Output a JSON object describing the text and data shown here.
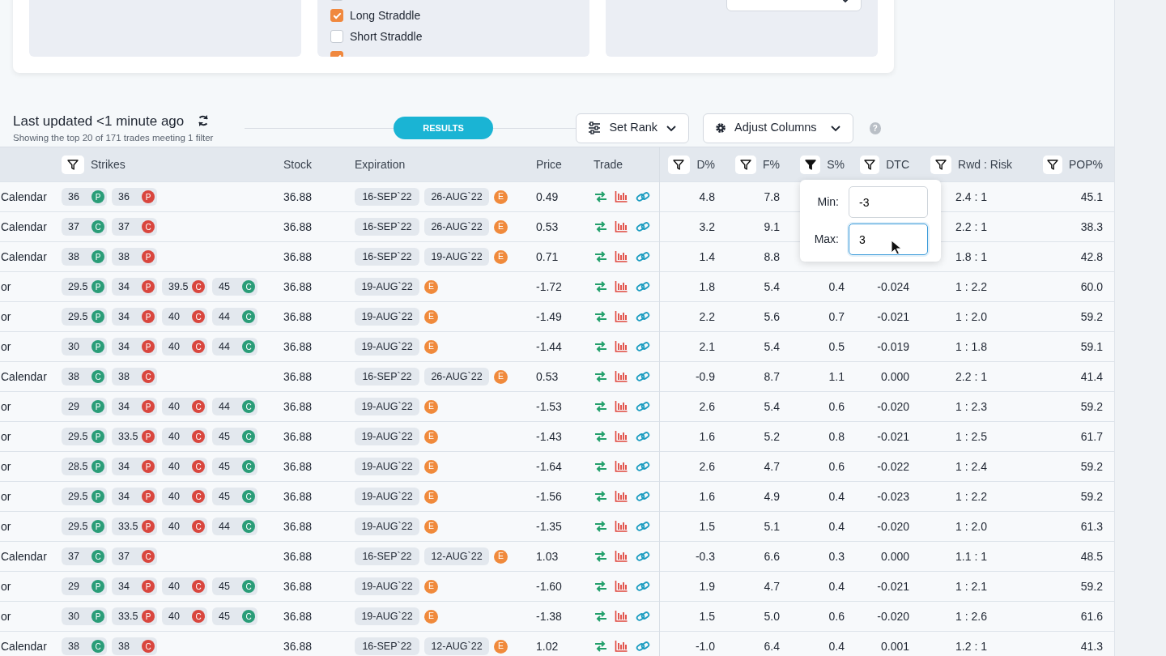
{
  "filters_panel": {
    "strategies": [
      {
        "checked": false
      },
      {
        "label": "Long Straddle",
        "checked": true
      },
      {
        "label": "Short Straddle",
        "checked": false
      },
      {
        "checked": true
      }
    ],
    "strikes_select_open": false
  },
  "toolbar": {
    "title": "Last updated <1 minute ago",
    "subtitle": "Showing the top 20 of 171 trades meeting 1 filter",
    "results": "RESULTS",
    "set_rank": "Set Rank",
    "adjust_columns": "Adjust Columns",
    "help": "?"
  },
  "table": {
    "columns": [
      {
        "label": "Strikes",
        "filter": true,
        "filter_active": false
      },
      {
        "label": "Stock",
        "filter": false
      },
      {
        "label": "Expiration",
        "filter": false
      },
      {
        "label": "Price",
        "filter": false
      },
      {
        "label": "Trade",
        "filter": false
      },
      {
        "label": "D%",
        "filter": true,
        "filter_active": false
      },
      {
        "label": "F%",
        "filter": true,
        "filter_active": false
      },
      {
        "label": "S%",
        "filter": true,
        "filter_active": true
      },
      {
        "label": "DTC",
        "filter": true,
        "filter_active": false
      },
      {
        "label": "Rwd : Risk",
        "filter": true,
        "filter_active": false
      },
      {
        "label": "POP%",
        "filter": true,
        "filter_active": false
      }
    ],
    "rows": [
      {
        "name": "Calendar",
        "strikes": [
          {
            "value": "36",
            "type": "P",
            "color": "#2a9d78"
          },
          {
            "value": "36",
            "type": "P",
            "color": "#d9463e"
          }
        ],
        "stock": "36.88",
        "expirations": [
          "16-SEP`22",
          "26-AUG`22"
        ],
        "earnings": "E",
        "price": "0.49",
        "d": "4.8",
        "f": "7.8",
        "rwd": "2.4 : 1",
        "pop": "45.1"
      },
      {
        "name": "Calendar",
        "strikes": [
          {
            "value": "37",
            "type": "C",
            "color": "#2a9d78"
          },
          {
            "value": "37",
            "type": "C",
            "color": "#d9463e"
          }
        ],
        "stock": "36.88",
        "expirations": [
          "16-SEP`22",
          "26-AUG`22"
        ],
        "earnings": "E",
        "price": "0.53",
        "d": "3.2",
        "f": "9.1",
        "rwd": "2.2 : 1",
        "pop": "38.3"
      },
      {
        "name": "Calendar",
        "strikes": [
          {
            "value": "38",
            "type": "P",
            "color": "#2a9d78"
          },
          {
            "value": "38",
            "type": "P",
            "color": "#d9463e"
          }
        ],
        "stock": "36.88",
        "expirations": [
          "16-SEP`22",
          "19-AUG`22"
        ],
        "earnings": "E",
        "price": "0.71",
        "d": "1.4",
        "f": "8.8",
        "rwd": "1.8 : 1",
        "pop": "42.8"
      },
      {
        "name": "or",
        "strikes": [
          {
            "value": "29.5",
            "type": "P",
            "color": "#2a9d78"
          },
          {
            "value": "34",
            "type": "P",
            "color": "#d9463e"
          },
          {
            "value": "39.5",
            "type": "C",
            "color": "#d9463e"
          },
          {
            "value": "45",
            "type": "C",
            "color": "#2a9d78"
          }
        ],
        "stock": "36.88",
        "expirations": [
          "19-AUG`22"
        ],
        "earnings": "E",
        "price": "-1.72",
        "d": "1.8",
        "f": "5.4",
        "s": "0.4",
        "dtc": "-0.024",
        "rwd": "1 : 2.2",
        "pop": "60.0"
      },
      {
        "name": "or",
        "strikes": [
          {
            "value": "29.5",
            "type": "P",
            "color": "#2a9d78"
          },
          {
            "value": "34",
            "type": "P",
            "color": "#d9463e"
          },
          {
            "value": "40",
            "type": "C",
            "color": "#d9463e"
          },
          {
            "value": "44",
            "type": "C",
            "color": "#2a9d78"
          }
        ],
        "stock": "36.88",
        "expirations": [
          "19-AUG`22"
        ],
        "earnings": "E",
        "price": "-1.49",
        "d": "2.2",
        "f": "5.6",
        "s": "0.7",
        "dtc": "-0.021",
        "rwd": "1 : 2.0",
        "pop": "59.2"
      },
      {
        "name": "or",
        "strikes": [
          {
            "value": "30",
            "type": "P",
            "color": "#2a9d78"
          },
          {
            "value": "34",
            "type": "P",
            "color": "#d9463e"
          },
          {
            "value": "40",
            "type": "C",
            "color": "#d9463e"
          },
          {
            "value": "44",
            "type": "C",
            "color": "#2a9d78"
          }
        ],
        "stock": "36.88",
        "expirations": [
          "19-AUG`22"
        ],
        "earnings": "E",
        "price": "-1.44",
        "d": "2.1",
        "f": "5.4",
        "s": "0.5",
        "dtc": "-0.019",
        "rwd": "1 : 1.8",
        "pop": "59.1"
      },
      {
        "name": "Calendar",
        "strikes": [
          {
            "value": "38",
            "type": "C",
            "color": "#2a9d78"
          },
          {
            "value": "38",
            "type": "C",
            "color": "#d9463e"
          }
        ],
        "stock": "36.88",
        "expirations": [
          "16-SEP`22",
          "26-AUG`22"
        ],
        "earnings": "E",
        "price": "0.53",
        "d": "-0.9",
        "f": "8.7",
        "s": "1.1",
        "dtc": "0.000",
        "rwd": "2.2 : 1",
        "pop": "41.4"
      },
      {
        "name": "or",
        "strikes": [
          {
            "value": "29",
            "type": "P",
            "color": "#2a9d78"
          },
          {
            "value": "34",
            "type": "P",
            "color": "#d9463e"
          },
          {
            "value": "40",
            "type": "C",
            "color": "#d9463e"
          },
          {
            "value": "44",
            "type": "C",
            "color": "#2a9d78"
          }
        ],
        "stock": "36.88",
        "expirations": [
          "19-AUG`22"
        ],
        "earnings": "E",
        "price": "-1.53",
        "d": "2.6",
        "f": "5.4",
        "s": "0.6",
        "dtc": "-0.020",
        "rwd": "1 : 2.3",
        "pop": "59.2"
      },
      {
        "name": "or",
        "strikes": [
          {
            "value": "29.5",
            "type": "P",
            "color": "#2a9d78"
          },
          {
            "value": "33.5",
            "type": "P",
            "color": "#d9463e"
          },
          {
            "value": "40",
            "type": "C",
            "color": "#d9463e"
          },
          {
            "value": "45",
            "type": "C",
            "color": "#2a9d78"
          }
        ],
        "stock": "36.88",
        "expirations": [
          "19-AUG`22"
        ],
        "earnings": "E",
        "price": "-1.43",
        "d": "1.6",
        "f": "5.2",
        "s": "0.8",
        "dtc": "-0.021",
        "rwd": "1 : 2.5",
        "pop": "61.7"
      },
      {
        "name": "or",
        "strikes": [
          {
            "value": "28.5",
            "type": "P",
            "color": "#2a9d78"
          },
          {
            "value": "34",
            "type": "P",
            "color": "#d9463e"
          },
          {
            "value": "40",
            "type": "C",
            "color": "#d9463e"
          },
          {
            "value": "45",
            "type": "C",
            "color": "#2a9d78"
          }
        ],
        "stock": "36.88",
        "expirations": [
          "19-AUG`22"
        ],
        "earnings": "E",
        "price": "-1.64",
        "d": "2.6",
        "f": "4.7",
        "s": "0.6",
        "dtc": "-0.022",
        "rwd": "1 : 2.4",
        "pop": "59.2"
      },
      {
        "name": "or",
        "strikes": [
          {
            "value": "29.5",
            "type": "P",
            "color": "#2a9d78"
          },
          {
            "value": "34",
            "type": "P",
            "color": "#d9463e"
          },
          {
            "value": "40",
            "type": "C",
            "color": "#d9463e"
          },
          {
            "value": "45",
            "type": "C",
            "color": "#2a9d78"
          }
        ],
        "stock": "36.88",
        "expirations": [
          "19-AUG`22"
        ],
        "earnings": "E",
        "price": "-1.56",
        "d": "1.6",
        "f": "4.9",
        "s": "0.4",
        "dtc": "-0.023",
        "rwd": "1 : 2.2",
        "pop": "59.2"
      },
      {
        "name": "or",
        "strikes": [
          {
            "value": "29.5",
            "type": "P",
            "color": "#2a9d78"
          },
          {
            "value": "33.5",
            "type": "P",
            "color": "#d9463e"
          },
          {
            "value": "40",
            "type": "C",
            "color": "#d9463e"
          },
          {
            "value": "44",
            "type": "C",
            "color": "#2a9d78"
          }
        ],
        "stock": "36.88",
        "expirations": [
          "19-AUG`22"
        ],
        "earnings": "E",
        "price": "-1.35",
        "d": "1.5",
        "f": "5.1",
        "s": "0.4",
        "dtc": "-0.020",
        "rwd": "1 : 2.0",
        "pop": "61.3"
      },
      {
        "name": "Calendar",
        "strikes": [
          {
            "value": "37",
            "type": "C",
            "color": "#2a9d78"
          },
          {
            "value": "37",
            "type": "C",
            "color": "#d9463e"
          }
        ],
        "stock": "36.88",
        "expirations": [
          "16-SEP`22",
          "12-AUG`22"
        ],
        "earnings": "E",
        "price": "1.03",
        "d": "-0.3",
        "f": "6.6",
        "s": "0.3",
        "dtc": "0.000",
        "rwd": "1.1 : 1",
        "pop": "48.5"
      },
      {
        "name": "or",
        "strikes": [
          {
            "value": "29",
            "type": "P",
            "color": "#2a9d78"
          },
          {
            "value": "34",
            "type": "P",
            "color": "#d9463e"
          },
          {
            "value": "40",
            "type": "C",
            "color": "#d9463e"
          },
          {
            "value": "45",
            "type": "C",
            "color": "#2a9d78"
          }
        ],
        "stock": "36.88",
        "expirations": [
          "19-AUG`22"
        ],
        "earnings": "E",
        "price": "-1.60",
        "d": "1.9",
        "f": "4.7",
        "s": "0.4",
        "dtc": "-0.021",
        "rwd": "1 : 2.1",
        "pop": "59.2"
      },
      {
        "name": "or",
        "strikes": [
          {
            "value": "30",
            "type": "P",
            "color": "#2a9d78"
          },
          {
            "value": "33.5",
            "type": "P",
            "color": "#d9463e"
          },
          {
            "value": "40",
            "type": "C",
            "color": "#d9463e"
          },
          {
            "value": "45",
            "type": "C",
            "color": "#2a9d78"
          }
        ],
        "stock": "36.88",
        "expirations": [
          "19-AUG`22"
        ],
        "earnings": "E",
        "price": "-1.38",
        "d": "1.5",
        "f": "5.0",
        "s": "0.6",
        "dtc": "-0.020",
        "rwd": "1 : 2.6",
        "pop": "61.6"
      },
      {
        "name": "Calendar",
        "strikes": [
          {
            "value": "38",
            "type": "C",
            "color": "#2a9d78"
          },
          {
            "value": "38",
            "type": "C",
            "color": "#d9463e"
          }
        ],
        "stock": "36.88",
        "expirations": [
          "16-SEP`22",
          "12-AUG`22"
        ],
        "earnings": "E",
        "price": "1.02",
        "d": "-1.0",
        "f": "6.4",
        "s": "0.4",
        "dtc": "0.001",
        "rwd": "1.2 : 1",
        "pop": "41.3"
      }
    ]
  },
  "range_filter": {
    "min_label": "Min:",
    "min_value": "-3",
    "max_label": "Max:",
    "max_value": "3",
    "max_focused": true
  }
}
